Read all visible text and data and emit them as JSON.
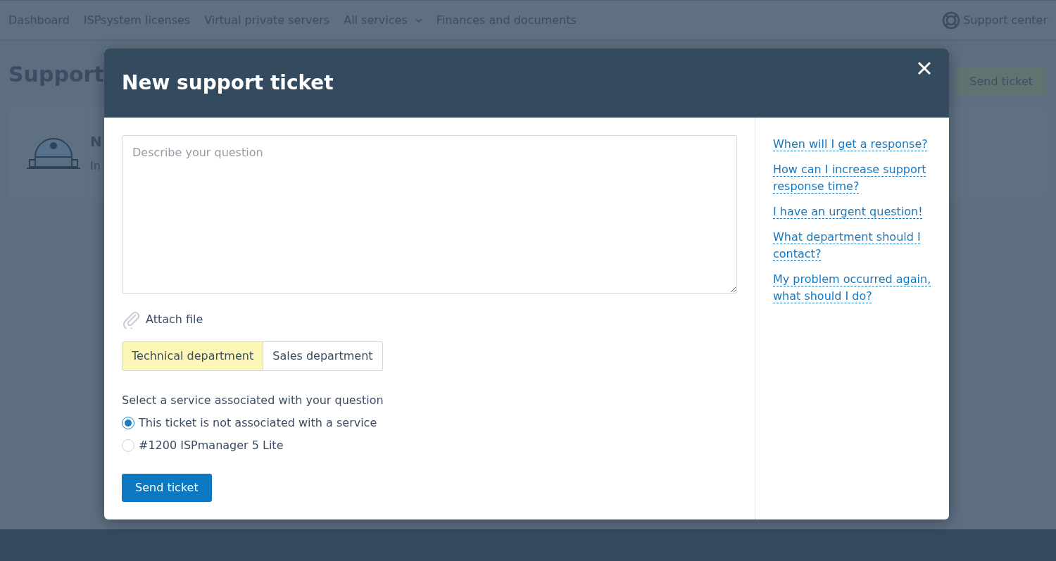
{
  "nav": {
    "items": [
      {
        "label": "Dashboard",
        "dropdown": false
      },
      {
        "label": "ISPsystem licenses",
        "dropdown": false
      },
      {
        "label": "Virtual private servers",
        "dropdown": false
      },
      {
        "label": "All services",
        "dropdown": true
      },
      {
        "label": "Finances and documents",
        "dropdown": false
      }
    ],
    "support_link": "Support center"
  },
  "page": {
    "title": "Support",
    "send_button": "Send ticket",
    "card": {
      "title": "N",
      "text": "In"
    }
  },
  "modal": {
    "title": "New support ticket",
    "question": {
      "placeholder": "Describe your question"
    },
    "attach": "Attach file",
    "departments": [
      {
        "label": "Technical department",
        "selected": true
      },
      {
        "label": "Sales department",
        "selected": false
      }
    ],
    "service_prompt": "Select a service associated with your question",
    "services": [
      {
        "label": "This ticket is not associated with a service",
        "selected": true
      },
      {
        "label": "#1200 ISPmanager 5 Lite",
        "selected": false
      }
    ],
    "submit": "Send ticket",
    "help_links": [
      "When will I get a response?",
      "How can I increase support response time?",
      "I have an urgent question!",
      "What department should I contact?",
      "My problem occurred again, what should I do?"
    ]
  }
}
